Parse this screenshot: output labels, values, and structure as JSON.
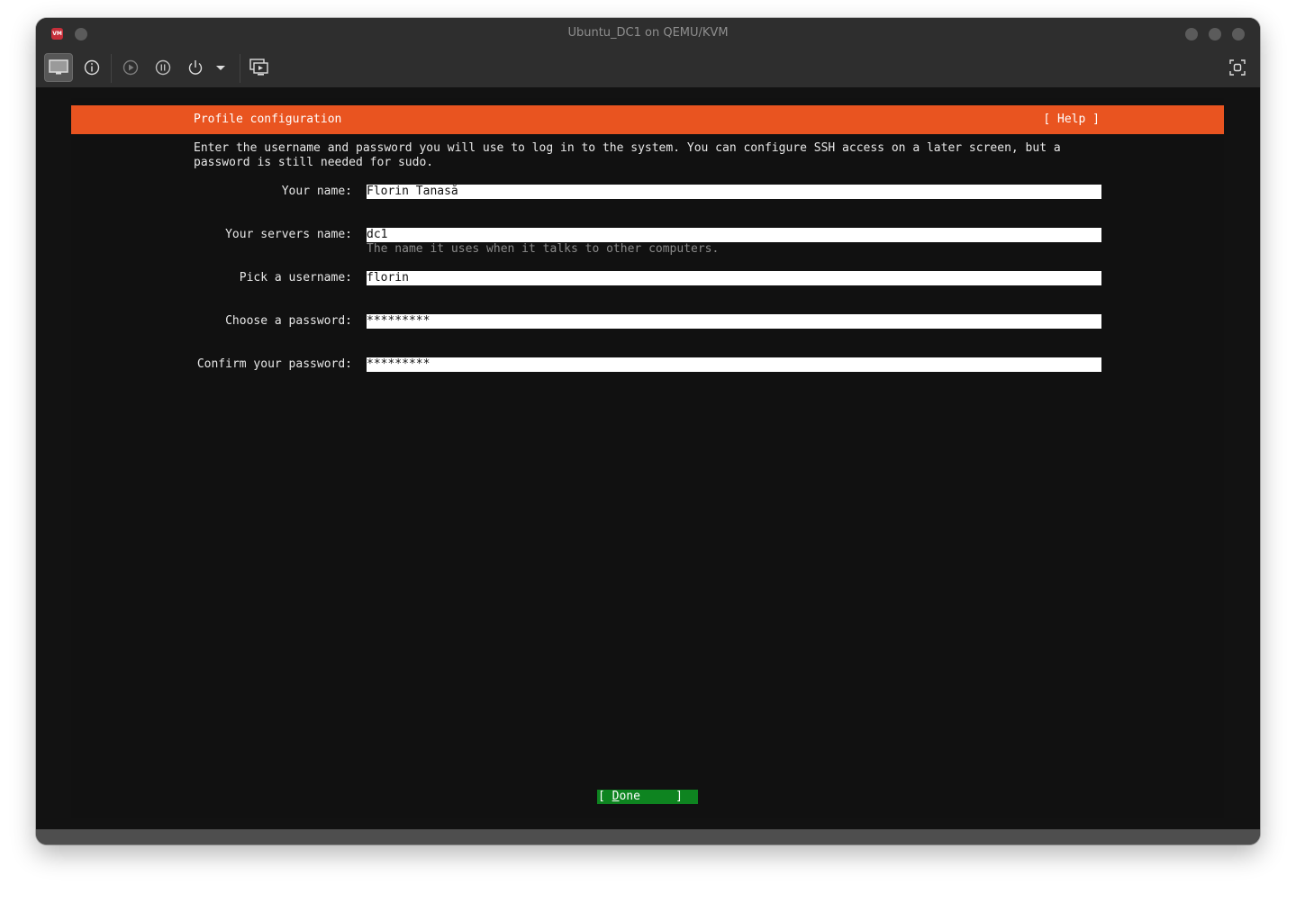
{
  "window": {
    "title": "Ubuntu_DC1 on QEMU/KVM",
    "app_icon_text": "VM"
  },
  "toolbar": {
    "buttons": [
      {
        "name": "show-console-button",
        "icon": "monitor-icon",
        "active": true
      },
      {
        "name": "show-details-button",
        "icon": "info-icon",
        "active": false
      },
      {
        "name": "run-button",
        "icon": "play-icon",
        "active": false
      },
      {
        "name": "pause-button",
        "icon": "pause-icon",
        "active": false
      },
      {
        "name": "shutdown-button",
        "icon": "power-icon",
        "active": false
      },
      {
        "name": "shutdown-menu-button",
        "icon": "caret-down-icon",
        "active": false
      },
      {
        "name": "snapshots-button",
        "icon": "screens-icon",
        "active": false
      },
      {
        "name": "fullscreen-button",
        "icon": "fullscreen-icon",
        "active": false
      }
    ]
  },
  "installer": {
    "header_title": "Profile configuration",
    "help_label": "[ Help ]",
    "intro": "Enter the username and password you will use to log in to the system. You can configure SSH access on a later screen, but a\npassword is still needed for sudo.",
    "fields": [
      {
        "label": "Your name:",
        "value": "Florin Tanasă"
      },
      {
        "label": "Your servers name:",
        "value": "dc1",
        "hint": "The name it uses when it talks to other computers."
      },
      {
        "label": "Pick a username:",
        "value": "florin"
      },
      {
        "label": "Choose a password:",
        "value": "*********"
      },
      {
        "label": "Confirm your password:",
        "value": "*********"
      }
    ],
    "done_button": {
      "open": "[ ",
      "hotkey": "D",
      "rest": "one",
      "close": "     ]"
    }
  },
  "colors": {
    "header_orange": "#e95420",
    "done_green": "#0e8420",
    "terminal_bg": "#111111"
  }
}
